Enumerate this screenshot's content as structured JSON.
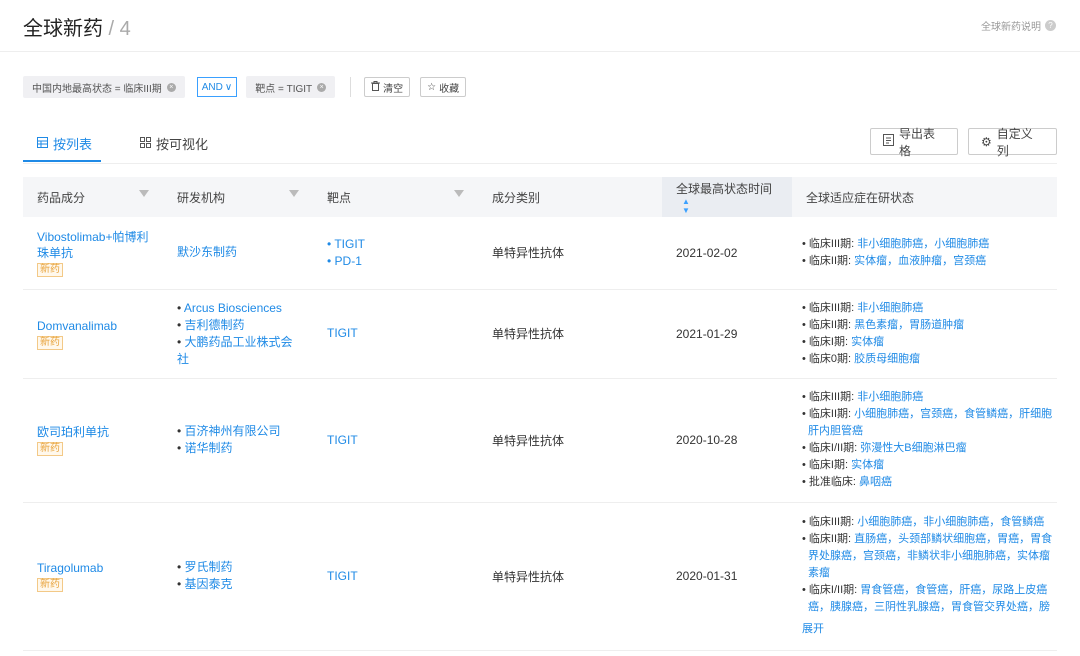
{
  "header": {
    "title": "全球新药",
    "separator": " / ",
    "count": "4",
    "help": "全球新药说明"
  },
  "filters": {
    "chip1": "中国内地最高状态 = 临床III期",
    "logic": "AND",
    "chip2": "靶点 = TIGIT",
    "clear": "清空",
    "save": "收藏"
  },
  "tabs": {
    "list": "按列表",
    "visual": "按可视化"
  },
  "actions": {
    "export": "导出表格",
    "custom_cols": "自定义列"
  },
  "table": {
    "headers": [
      "药品成分",
      "研发机构",
      "靶点",
      "成分类别",
      "全球最高状态时间",
      "全球适应症在研状态"
    ],
    "rows": [
      {
        "drug": "Vibostolimab+帕博利珠单抗",
        "badge": "新药",
        "orgs": [
          "默沙东制药"
        ],
        "targets": [
          "TIGIT",
          "PD-1"
        ],
        "category": "单特异性抗体",
        "date": "2021-02-02",
        "status": [
          {
            "label": "临床III期: ",
            "value": "非小细胞肺癌，小细胞肺癌"
          },
          {
            "label": "临床II期: ",
            "value": "实体瘤，血液肿瘤，宫颈癌"
          }
        ]
      },
      {
        "drug": "Domvanalimab",
        "badge": "新药",
        "orgs": [
          "Arcus Biosciences",
          "吉利德制药",
          "大鹏药品工业株式会社"
        ],
        "targets": [
          "TIGIT"
        ],
        "category": "单特异性抗体",
        "date": "2021-01-29",
        "status": [
          {
            "label": "临床III期: ",
            "value": "非小细胞肺癌"
          },
          {
            "label": "临床II期: ",
            "value": "黑色素瘤，胃肠道肿瘤"
          },
          {
            "label": "临床I期: ",
            "value": "实体瘤"
          },
          {
            "label": "临床0期: ",
            "value": "胶质母细胞瘤"
          }
        ]
      },
      {
        "drug": "欧司珀利单抗",
        "badge": "新药",
        "orgs": [
          "百济神州有限公司",
          "诺华制药"
        ],
        "targets": [
          "TIGIT"
        ],
        "category": "单特异性抗体",
        "date": "2020-10-28",
        "status": [
          {
            "label": "临床III期: ",
            "value": "非小细胞肺癌"
          },
          {
            "label": "临床II期: ",
            "value": "小细胞肺癌，宫颈癌，食管鳞癌，肝细胞"
          },
          {
            "label": "",
            "value": "肝内胆管癌",
            "indent": true
          },
          {
            "label": "临床I/II期: ",
            "value": "弥漫性大B细胞淋巴瘤"
          },
          {
            "label": "临床I期: ",
            "value": "实体瘤"
          },
          {
            "label": "批准临床: ",
            "value": "鼻咽癌"
          }
        ]
      },
      {
        "drug": "Tiragolumab",
        "badge": "新药",
        "orgs": [
          "罗氏制药",
          "基因泰克"
        ],
        "targets": [
          "TIGIT"
        ],
        "category": "单特异性抗体",
        "date": "2020-01-31",
        "status": [
          {
            "label": "临床III期: ",
            "value": "小细胞肺癌，非小细胞肺癌，食管鳞癌"
          },
          {
            "label": "临床II期: ",
            "value": "直肠癌，头颈部鳞状细胞癌，胃癌，胃食"
          },
          {
            "label": "",
            "value": "界处腺癌，宫颈癌，非鳞状非小细胞肺癌，实体瘤",
            "indent": true
          },
          {
            "label": "",
            "value": "素瘤",
            "indent": true
          },
          {
            "label": "临床I/II期: ",
            "value": "胃食管癌，食管癌，肝癌，尿路上皮癌"
          },
          {
            "label": "",
            "value": "癌，胰腺癌，三阴性乳腺癌，胃食管交界处癌，膀",
            "indent": true
          }
        ],
        "expand": "展开"
      }
    ]
  }
}
